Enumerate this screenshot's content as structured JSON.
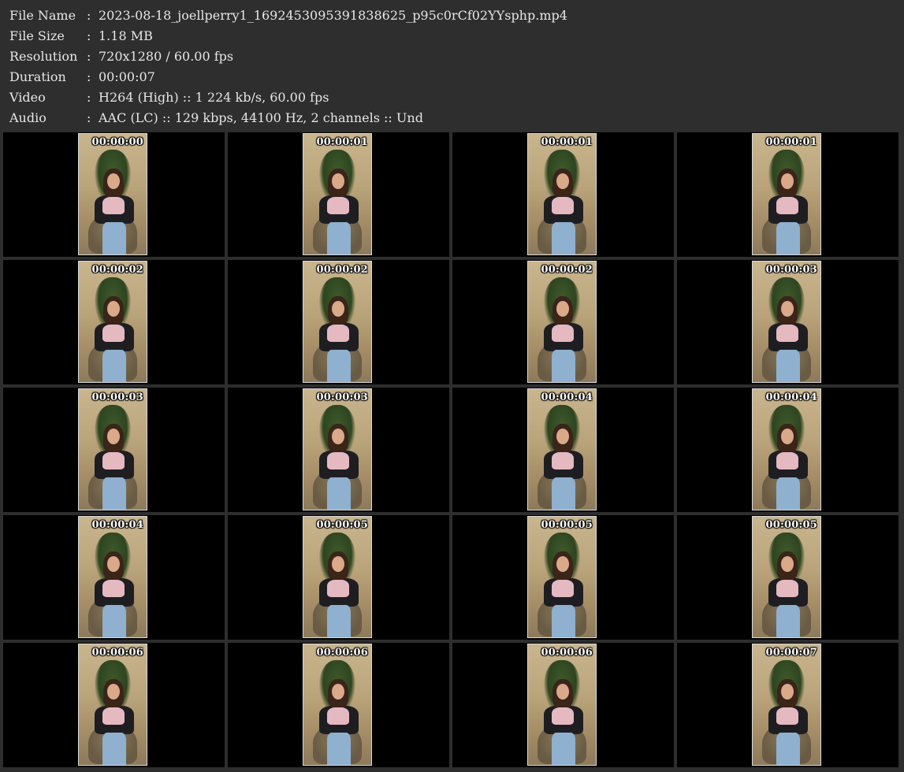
{
  "info": {
    "rows": [
      {
        "label": "File Name",
        "value": "2023-08-18_joellperry1_1692453095391838625_p95c0rCf02YYsphp.mp4"
      },
      {
        "label": "File Size",
        "value": "1.18 MB"
      },
      {
        "label": "Resolution",
        "value": "720x1280 / 60.00 fps"
      },
      {
        "label": "Duration",
        "value": "00:00:07"
      },
      {
        "label": "Video",
        "value": "H264 (High) :: 1 224 kb/s, 60.00 fps"
      },
      {
        "label": "Audio",
        "value": "AAC (LC) :: 129 kbps, 44100 Hz, 2 channels :: Und"
      }
    ],
    "separator": ":"
  },
  "thumbnails": [
    "00:00:00",
    "00:00:01",
    "00:00:01",
    "00:00:01",
    "00:00:02",
    "00:00:02",
    "00:00:02",
    "00:00:03",
    "00:00:03",
    "00:00:03",
    "00:00:04",
    "00:00:04",
    "00:00:04",
    "00:00:05",
    "00:00:05",
    "00:00:05",
    "00:00:06",
    "00:00:06",
    "00:00:06",
    "00:00:07"
  ],
  "colors": {
    "background": "#2e2e2e",
    "cell_background": "#000000",
    "text": "#e6e6e6"
  }
}
